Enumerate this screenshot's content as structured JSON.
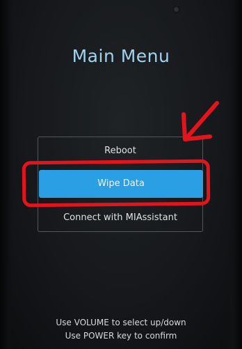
{
  "screen": {
    "title": "Main Menu"
  },
  "menu": {
    "items": [
      {
        "label": "Reboot",
        "selected": false
      },
      {
        "label": "Wipe Data",
        "selected": true
      },
      {
        "label": "Connect with MIAssistant",
        "selected": false
      }
    ]
  },
  "hints": {
    "line1": "Use VOLUME to select up/down",
    "line2": "Use POWER key to confirm"
  },
  "colors": {
    "title": "#9fd3ef",
    "selected_bg": "#2a9fe4",
    "annotation": "#e3141b"
  },
  "annotations": {
    "arrow_icon": "hand-drawn-arrow-icon",
    "highlight": "hand-drawn-rectangle"
  }
}
